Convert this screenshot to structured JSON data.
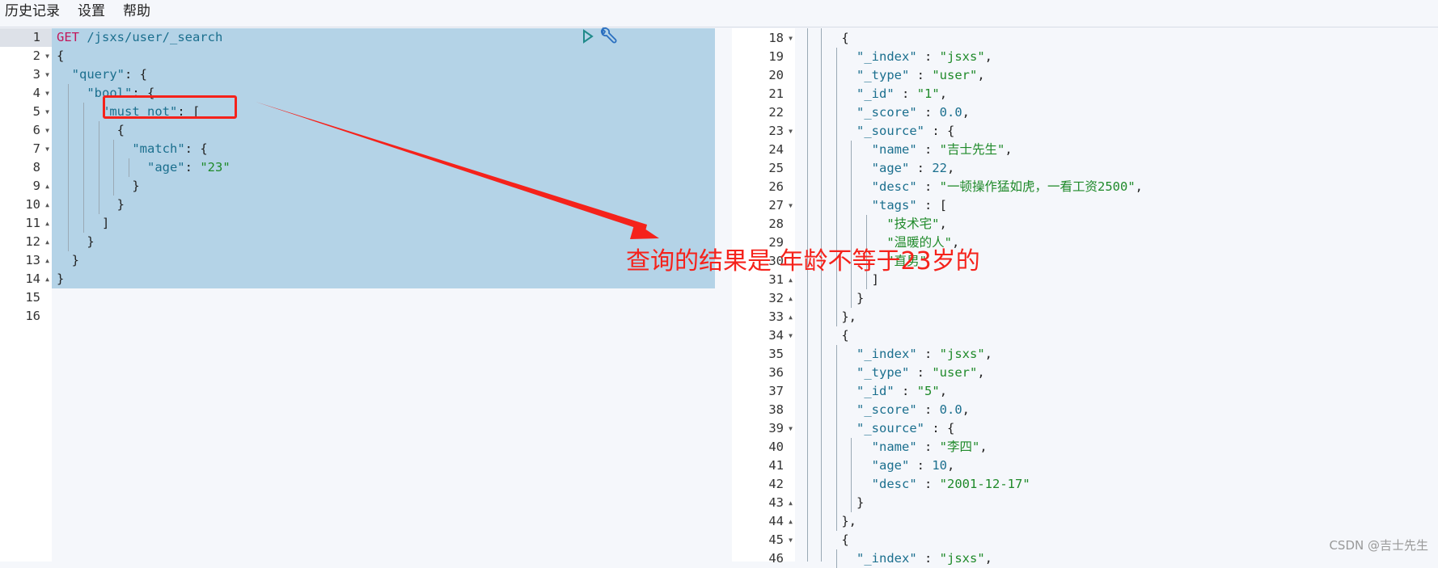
{
  "menu": {
    "items": [
      "历史记录",
      "设置",
      "帮助"
    ]
  },
  "request": {
    "first_line_start": 1,
    "method": "GET",
    "path": " /jsxs/user/_search",
    "lines": [
      "GET /jsxs/user/_search",
      "{",
      "  \"query\": {",
      "    \"bool\": {",
      "      \"must_not\": [",
      "        {",
      "          \"match\": {",
      "            \"age\": \"23\"",
      "          }",
      "        }",
      "      ]",
      "    }",
      "  }",
      "}",
      "",
      ""
    ],
    "folds": [
      "",
      "down",
      "down",
      "down",
      "down",
      "down",
      "down",
      "",
      "up",
      "up",
      "up",
      "up",
      "up",
      "up",
      "",
      ""
    ],
    "run_icon": "play-icon",
    "settings_icon": "wrench-icon"
  },
  "response": {
    "first_line": 18,
    "lines": [
      "    {",
      "      \"_index\" : \"jsxs\",",
      "      \"_type\" : \"user\",",
      "      \"_id\" : \"1\",",
      "      \"_score\" : 0.0,",
      "      \"_source\" : {",
      "        \"name\" : \"吉士先生\",",
      "        \"age\" : 22,",
      "        \"desc\" : \"一顿操作猛如虎，一看工资2500\",",
      "        \"tags\" : [",
      "          \"技术宅\",",
      "          \"温暖的人\",",
      "          \"直男\"",
      "        ]",
      "      }",
      "    },",
      "    {",
      "      \"_index\" : \"jsxs\",",
      "      \"_type\" : \"user\",",
      "      \"_id\" : \"5\",",
      "      \"_score\" : 0.0,",
      "      \"_source\" : {",
      "        \"name\" : \"李四\",",
      "        \"age\" : 10,",
      "        \"desc\" : \"2001-12-17\"",
      "      }",
      "    },",
      "    {",
      "      \"_index\" : \"jsxs\","
    ],
    "folds": [
      "down",
      "",
      "",
      "",
      "",
      "down",
      "",
      "",
      "",
      "down",
      "",
      "",
      "",
      "up",
      "up",
      "up",
      "down",
      "",
      "",
      "",
      "",
      "down",
      "",
      "",
      "",
      "up",
      "up",
      "down",
      ""
    ]
  },
  "annotation": {
    "text": "查询的结果是 年龄不等于23岁的",
    "color": "#f5221b"
  },
  "watermark": "CSDN @吉士先生",
  "colors": {
    "selection": "#b4d3e7",
    "key": "#1b6f8e",
    "string": "#1f8a2a",
    "method": "#c2185b"
  }
}
